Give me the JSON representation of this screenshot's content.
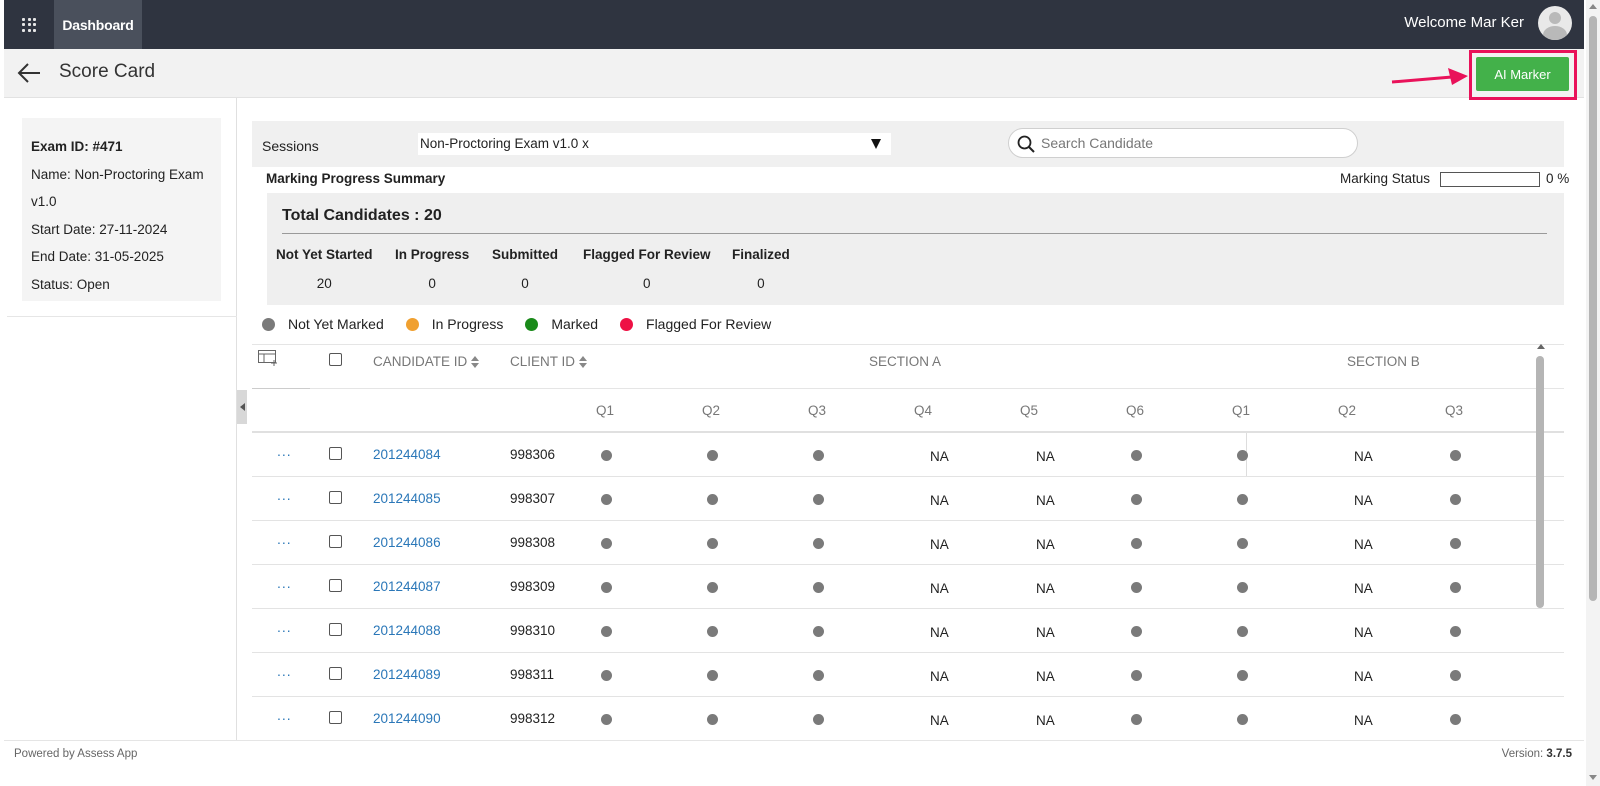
{
  "topbar": {
    "dashboard_label": "Dashboard",
    "welcome": "Welcome Mar Ker"
  },
  "header": {
    "title": "Score Card",
    "ai_marker_label": "AI Marker"
  },
  "exam": {
    "id": "Exam ID: #471",
    "name_line1": "Name: Non-Proctoring Exam",
    "name_line2": "v1.0",
    "start": "Start Date: 27-11-2024",
    "end": "End Date: 31-05-2025",
    "status": "Status: Open"
  },
  "sessions": {
    "label": "Sessions",
    "selected": "Non-Proctoring Exam v1.0 x"
  },
  "search": {
    "placeholder": "Search Candidate"
  },
  "marking": {
    "summary_title": "Marking Progress Summary",
    "status_label": "Marking Status",
    "status_percent": 0,
    "status_text": "0 %"
  },
  "summary": {
    "total": "Total Candidates : 20",
    "stats": [
      {
        "label": "Not Yet Started",
        "value": "20"
      },
      {
        "label": "In Progress",
        "value": "0"
      },
      {
        "label": "Submitted",
        "value": "0"
      },
      {
        "label": "Flagged For Review",
        "value": "0"
      },
      {
        "label": "Finalized",
        "value": "0"
      }
    ]
  },
  "legend": [
    {
      "label": "Not Yet Marked",
      "color": "#7a7a7a"
    },
    {
      "label": "In Progress",
      "color": "#f0a030"
    },
    {
      "label": "Marked",
      "color": "#1a8a1a"
    },
    {
      "label": "Flagged For Review",
      "color": "#ee1144"
    }
  ],
  "table": {
    "headers": {
      "candidate_id": "CANDIDATE ID",
      "client_id": "CLIENT ID",
      "section_a": "SECTION A",
      "section_b": "SECTION B",
      "section_a_q": [
        "Q1",
        "Q2",
        "Q3",
        "Q4",
        "Q5",
        "Q6"
      ],
      "section_b_q": [
        "Q1",
        "Q2",
        "Q3"
      ]
    },
    "row_menu": "...",
    "rows": [
      {
        "candidate": "201244084",
        "client": "998306",
        "cells": [
          "dot",
          "dot",
          "dot",
          "NA",
          "NA",
          "dot",
          "dot",
          "NA",
          "dot"
        ]
      },
      {
        "candidate": "201244085",
        "client": "998307",
        "cells": [
          "dot",
          "dot",
          "dot",
          "NA",
          "NA",
          "dot",
          "dot",
          "NA",
          "dot"
        ]
      },
      {
        "candidate": "201244086",
        "client": "998308",
        "cells": [
          "dot",
          "dot",
          "dot",
          "NA",
          "NA",
          "dot",
          "dot",
          "NA",
          "dot"
        ]
      },
      {
        "candidate": "201244087",
        "client": "998309",
        "cells": [
          "dot",
          "dot",
          "dot",
          "NA",
          "NA",
          "dot",
          "dot",
          "NA",
          "dot"
        ]
      },
      {
        "candidate": "201244088",
        "client": "998310",
        "cells": [
          "dot",
          "dot",
          "dot",
          "NA",
          "NA",
          "dot",
          "dot",
          "NA",
          "dot"
        ]
      },
      {
        "candidate": "201244089",
        "client": "998311",
        "cells": [
          "dot",
          "dot",
          "dot",
          "NA",
          "NA",
          "dot",
          "dot",
          "NA",
          "dot"
        ]
      },
      {
        "candidate": "201244090",
        "client": "998312",
        "cells": [
          "dot",
          "dot",
          "dot",
          "NA",
          "NA",
          "dot",
          "dot",
          "NA",
          "dot"
        ]
      }
    ]
  },
  "footer": {
    "powered": "Powered by Assess App",
    "version_label": "Version:",
    "version": "3.7.5"
  }
}
